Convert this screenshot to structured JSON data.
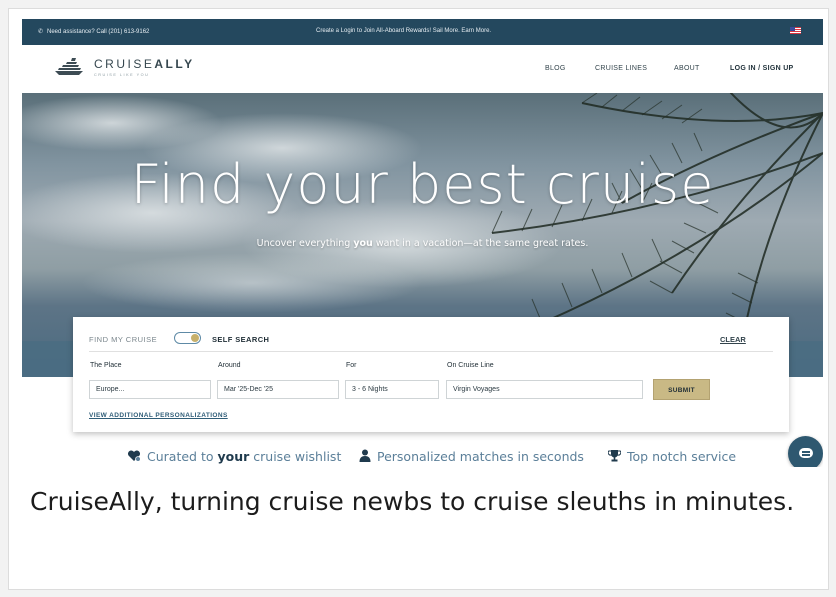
{
  "topbar": {
    "assistance": "Need assistance? Call (201) 613-9162",
    "promo": "Create a Login to Join All-Aboard Rewards! Sail More. Earn More."
  },
  "brand": {
    "name_light": "CRUISE",
    "name_bold": "ALLY",
    "tagline": "CRUISE LIKE YOU"
  },
  "nav": {
    "items": [
      "BLOG",
      "CRUISE LINES",
      "ABOUT"
    ],
    "login": "LOG IN / SIGN UP"
  },
  "hero": {
    "title": "Find your best cruise",
    "subtitle_pre": "Uncover everything ",
    "subtitle_bold": "you",
    "subtitle_post": " want in a vacation—at the same great rates."
  },
  "search": {
    "find_label": "FIND MY CRUISE",
    "mode_label": "SELF SEARCH",
    "clear_label": "CLEAR",
    "fields": {
      "place": {
        "label": "The Place",
        "value": "Europe..."
      },
      "around": {
        "label": "Around",
        "value": "Mar '25-Dec '25"
      },
      "for": {
        "label": "For",
        "value": "3 - 6 Nights"
      },
      "line": {
        "label": "On Cruise Line",
        "value": "Virgin Voyages"
      }
    },
    "submit_label": "SUBMIT",
    "more_link": "VIEW ADDITIONAL PERSONALIZATIONS"
  },
  "features": {
    "f1_pre": "Curated to ",
    "f1_bold": "your",
    "f1_post": " cruise wishlist",
    "f2": "Personalized matches in seconds",
    "f3": "Top notch service"
  },
  "caption": "CruiseAlly, turning cruise newbs to cruise sleuths in minutes.",
  "icons": [
    "phone-icon",
    "us-flag-icon",
    "ship-logo-icon",
    "heart-badge-icon",
    "user-icon",
    "trophy-icon",
    "chat-icon"
  ],
  "colors": {
    "topbar": "#24485e",
    "accent_gold": "#c9b985",
    "link_blue": "#2f5d78",
    "feature_text": "#5b7f99"
  }
}
